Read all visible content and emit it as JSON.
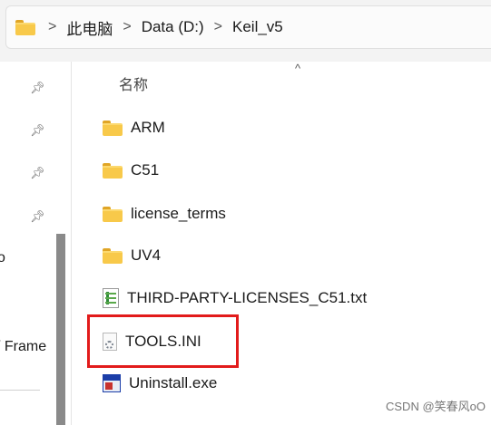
{
  "breadcrumb": {
    "items": [
      "此电脑",
      "Data (D:)",
      "Keil_v5"
    ],
    "separator": ">"
  },
  "nav": {
    "pinned_icons": [
      "pin-icon",
      "pin-icon",
      "pin-icon",
      "pin-icon"
    ],
    "partial_texts": [
      "o",
      "/ Frame"
    ]
  },
  "file_list": {
    "column_name": "名称",
    "sort_indicator": "^",
    "items": [
      {
        "name": "ARM",
        "icon": "folder-icon"
      },
      {
        "name": "C51",
        "icon": "folder-icon"
      },
      {
        "name": "license_terms",
        "icon": "folder-icon"
      },
      {
        "name": "UV4",
        "icon": "folder-icon"
      },
      {
        "name": "THIRD-PARTY-LICENSES_C51.txt",
        "icon": "text-file-icon"
      },
      {
        "name": "TOOLS.INI",
        "icon": "ini-file-icon"
      },
      {
        "name": "Uninstall.exe",
        "icon": "exe-icon"
      }
    ]
  },
  "colors": {
    "highlight": "#e21b1b",
    "folder": "#f8c94a"
  },
  "watermark": "CSDN @笑春风oO"
}
